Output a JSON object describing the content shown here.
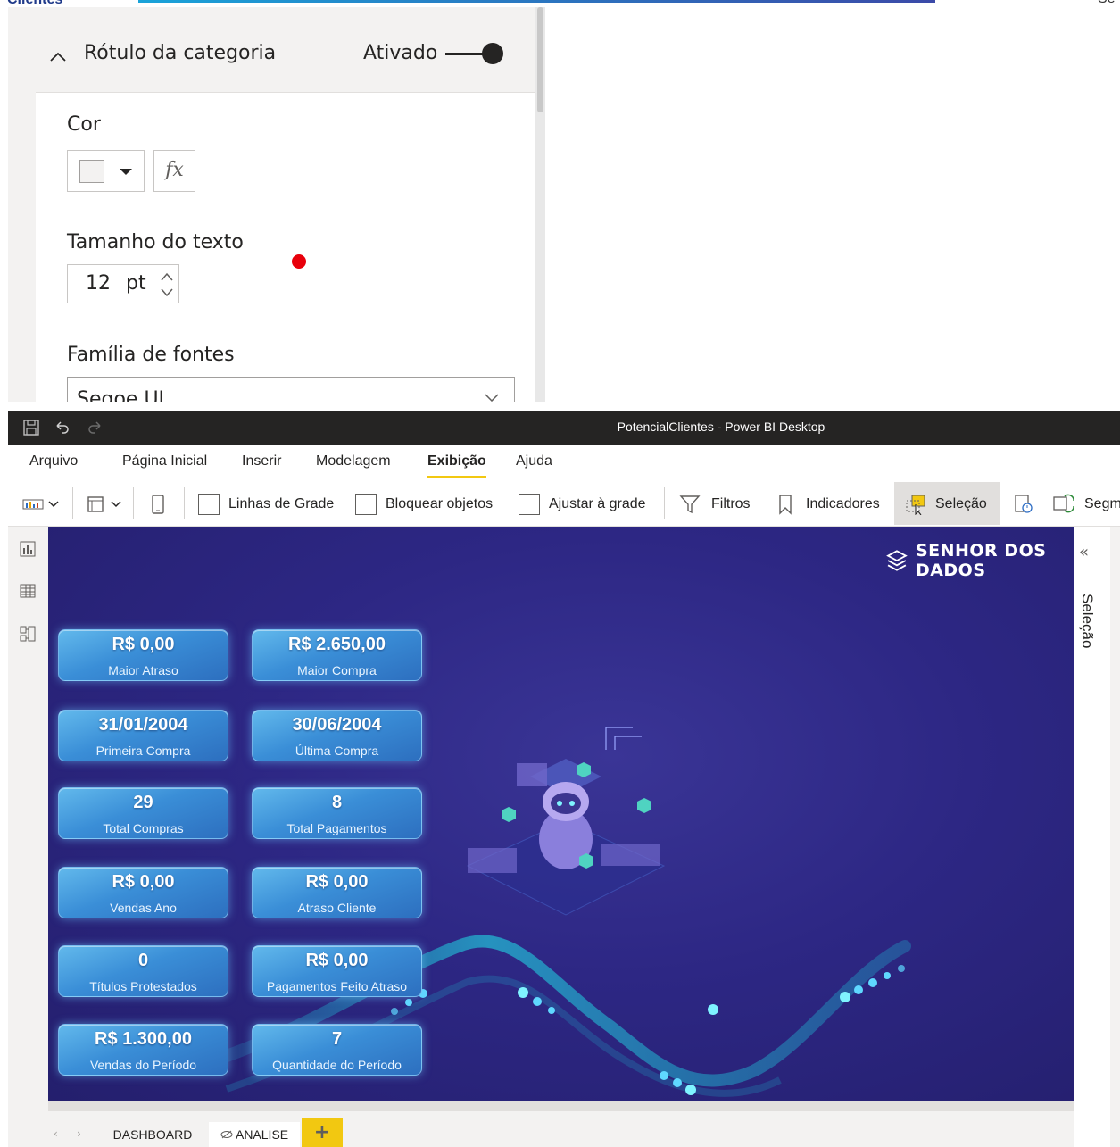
{
  "top_edge": {
    "left_text": "Clientes",
    "right_text": "Se"
  },
  "format_pane": {
    "section_title": "Rótulo da categoria",
    "toggle_state": "Ativado",
    "color_label": "Cor",
    "fx_label": "fx",
    "text_size_label": "Tamanho do texto",
    "text_size_value": "12",
    "text_size_unit": "pt",
    "font_family_label": "Família de fontes",
    "font_family_value": "Segoe UI"
  },
  "window": {
    "title": "PotencialClientes - Power BI Desktop"
  },
  "menu": {
    "items": [
      "Arquivo",
      "Página Inicial",
      "Inserir",
      "Modelagem",
      "Exibição",
      "Ajuda"
    ],
    "active": "Exibição"
  },
  "ribbon": {
    "gridlines": "Linhas de Grade",
    "lock_objects": "Bloquear objetos",
    "snap_to_grid": "Ajustar à grade",
    "filters": "Filtros",
    "bookmarks": "Indicadores",
    "selection": "Seleção",
    "sync_slicers_partial": "Segm"
  },
  "logo": {
    "text": "SENHOR DOS DADOS"
  },
  "cards": [
    {
      "value": "R$ 0,00",
      "label": "Maior Atraso"
    },
    {
      "value": "R$ 2.650,00",
      "label": "Maior Compra"
    },
    {
      "value": "31/01/2004",
      "label": "Primeira Compra"
    },
    {
      "value": "30/06/2004",
      "label": "Última Compra"
    },
    {
      "value": "29",
      "label": "Total Compras"
    },
    {
      "value": "8",
      "label": "Total Pagamentos"
    },
    {
      "value": "R$ 0,00",
      "label": "Vendas Ano"
    },
    {
      "value": "R$ 0,00",
      "label": "Atraso Cliente"
    },
    {
      "value": "0",
      "label": "Títulos Protestados"
    },
    {
      "value": "R$ 0,00",
      "label": "Pagamentos Feito Atraso"
    },
    {
      "value": "R$ 1.300,00",
      "label": "Vendas do Período"
    },
    {
      "value": "7",
      "label": "Quantidade do Período"
    }
  ],
  "right_pane": {
    "label": "Seleção"
  },
  "tabs": {
    "items": [
      "DASHBOARD",
      "ANALISE"
    ],
    "active": "ANALISE",
    "add_label": "+"
  },
  "colors": {
    "canvas": "#2d2784",
    "card": "#3a8ed7",
    "accent": "#f2c811",
    "titlebar": "#252423"
  }
}
